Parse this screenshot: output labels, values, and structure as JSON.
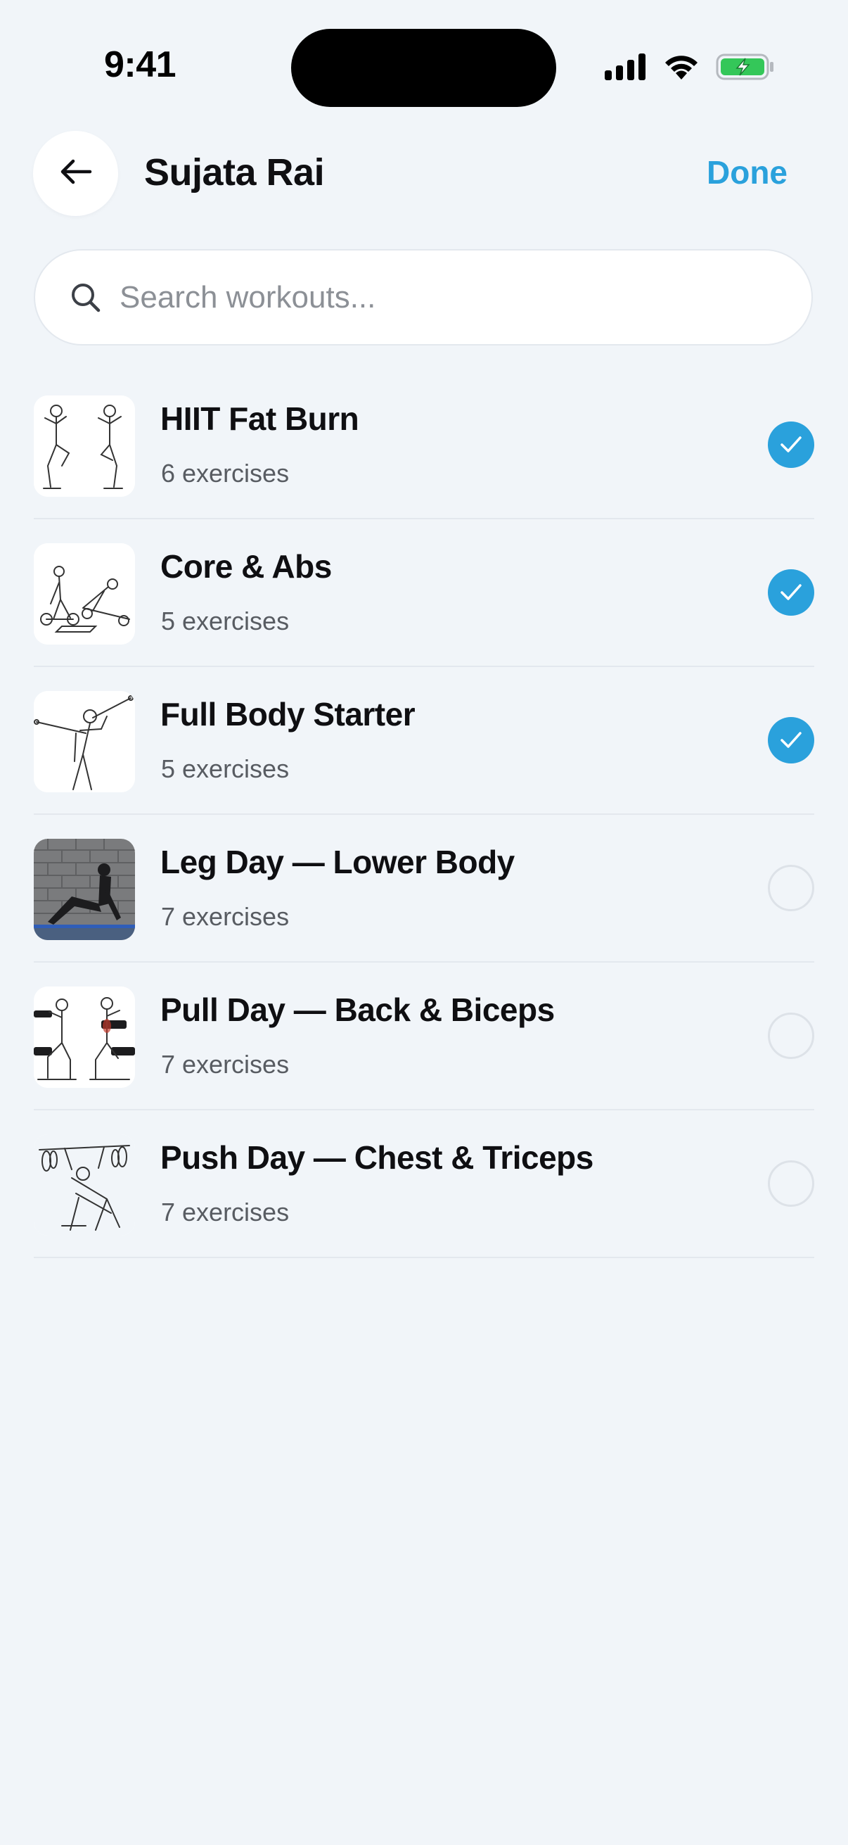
{
  "status_bar": {
    "time": "9:41"
  },
  "header": {
    "title": "Sujata Rai",
    "done_label": "Done"
  },
  "search": {
    "placeholder": "Search workouts...",
    "value": ""
  },
  "workouts": [
    {
      "name": "HIIT Fat Burn",
      "count": "6 exercises",
      "selected": true
    },
    {
      "name": "Core & Abs",
      "count": "5 exercises",
      "selected": true
    },
    {
      "name": "Full Body Starter",
      "count": "5 exercises",
      "selected": true
    },
    {
      "name": "Leg Day — Lower Body",
      "count": "7 exercises",
      "selected": false
    },
    {
      "name": "Pull Day — Back & Biceps",
      "count": "7 exercises",
      "selected": false
    },
    {
      "name": "Push Day — Chest & Triceps",
      "count": "7 exercises",
      "selected": false
    }
  ],
  "colors": {
    "accent": "#2aa1dc",
    "background": "#f1f5f9",
    "battery": "#34c759"
  }
}
